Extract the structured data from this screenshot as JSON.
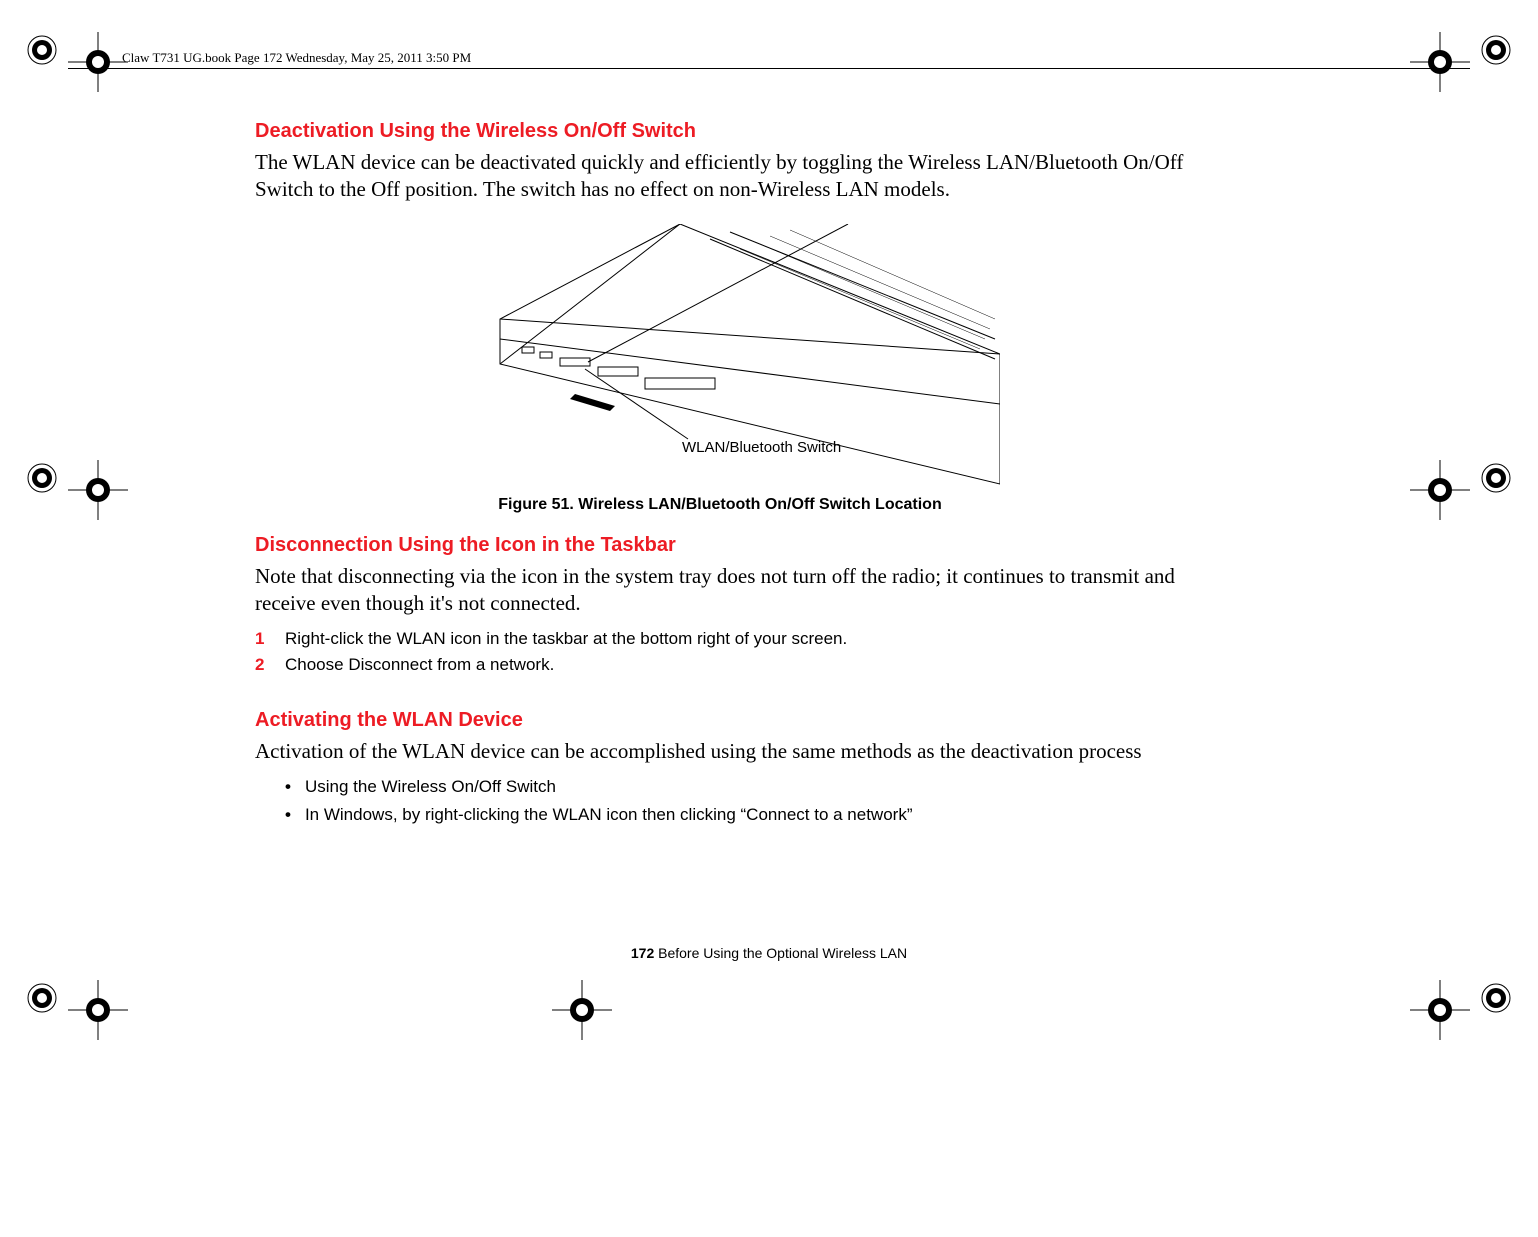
{
  "header": {
    "runningHead": "Claw T731 UG.book  Page 172  Wednesday, May 25, 2011  3:50 PM"
  },
  "section1": {
    "heading": "Deactivation Using the Wireless On/Off Switch",
    "body": "The WLAN device can be deactivated quickly and efficiently by toggling the Wireless LAN/Bluetooth On/Off Switch to the Off position. The switch has no effect on non-Wireless LAN models."
  },
  "figure": {
    "switchLabel": "WLAN/Bluetooth Switch",
    "caption": "Figure 51.  Wireless LAN/Bluetooth On/Off Switch Location"
  },
  "section2": {
    "heading": "Disconnection Using the Icon in the Taskbar",
    "body": "Note that disconnecting via the icon in the system tray does not turn off the radio; it continues to transmit and receive even though it's not connected.",
    "steps": [
      {
        "num": "1",
        "text": "Right-click the WLAN icon in the taskbar at the bottom right of your screen."
      },
      {
        "num": "2",
        "text": "Choose Disconnect from a network."
      }
    ]
  },
  "section3": {
    "heading": "Activating the WLAN Device",
    "body": "Activation of the WLAN device can be accomplished using the same methods as the deactivation process",
    "bullets": [
      "Using the Wireless On/Off Switch",
      "In Windows, by right-clicking the WLAN icon then clicking “Connect to a network”"
    ]
  },
  "footer": {
    "pageNumber": "172",
    "sectionTitle": " Before Using the Optional Wireless LAN"
  }
}
